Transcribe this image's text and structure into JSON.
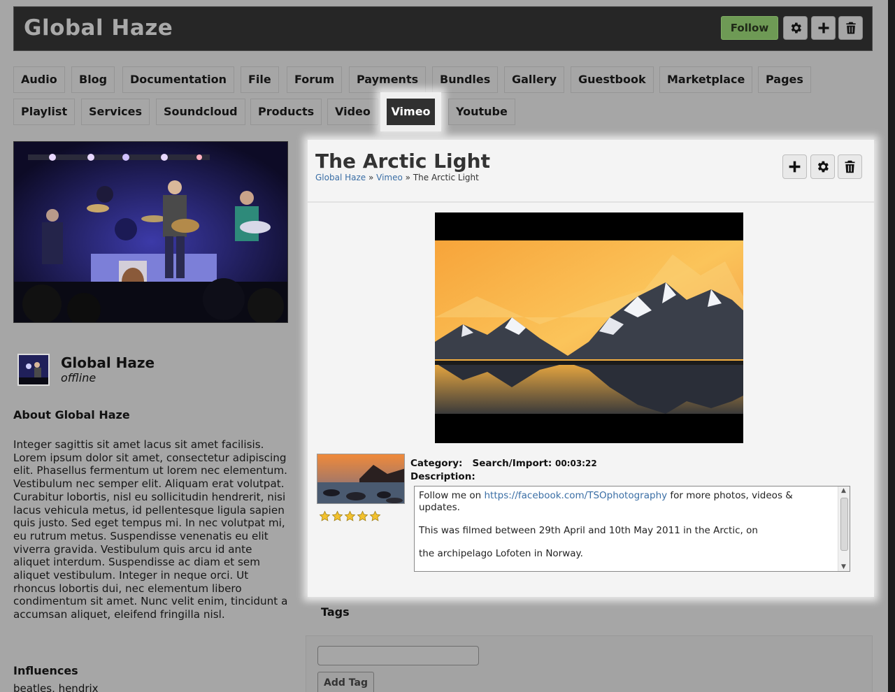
{
  "header": {
    "title": "Global Haze",
    "follow_label": "Follow"
  },
  "tabs": [
    "Audio",
    "Blog",
    "Documentation",
    "File",
    "Forum",
    "Payments",
    "Bundles",
    "Gallery",
    "Guestbook",
    "Marketplace",
    "Pages",
    "Playlist",
    "Services",
    "Soundcloud",
    "Products",
    "Video",
    "Vimeo",
    "Youtube"
  ],
  "active_tab": "Vimeo",
  "profile": {
    "name": "Global Haze",
    "status": "offline",
    "about_title": "About Global Haze",
    "about_text": "Integer sagittis sit amet lacus sit amet facilisis. Lorem ipsum dolor sit amet, consectetur adipiscing elit. Phasellus fermentum ut lorem nec elementum. Vestibulum nec semper elit. Aliquam erat volutpat. Curabitur lobortis, nisl eu sollicitudin hendrerit, nisi lacus vehicula metus, id pellentesque ligula sapien quis justo. Sed eget tempus mi. In nec volutpat mi, eu rutrum metus. Suspendisse venenatis eu elit viverra gravida. Vestibulum quis arcu id ante aliquet interdum. Suspendisse ac diam et sem aliquet vestibulum. Integer in neque orci. Ut rhoncus lobortis dui, nec elementum libero condimentum sit amet. Nunc velit enim, tincidunt a accumsan aliquet, eleifend fringilla nisl.",
    "influences_title": "Influences",
    "influences_text": "beatles, hendrix"
  },
  "item": {
    "title": "The Arctic Light",
    "breadcrumb": {
      "home": "Global Haze",
      "sep1": " » ",
      "section": "Vimeo",
      "sep2": " » ",
      "current": "The Arctic Light"
    },
    "category_label": "Category:",
    "search_label": "Search/Import:",
    "duration": "00:03:22",
    "description_label": "Description:",
    "description": {
      "line1_prefix": "Follow me on ",
      "line1_link": "https://facebook.com/TSOphotography",
      "line1_suffix": " for more photos, videos & updates.",
      "line2": "This was filmed between 29th April and 10th May 2011 in the Arctic, on",
      "line3": "the archipelago Lofoten in Norway."
    },
    "rating": 5
  },
  "tags": {
    "title": "Tags",
    "input_value": "",
    "add_label": "Add Tag"
  },
  "icons": {
    "settings": "gear-icon",
    "add": "plus-icon",
    "delete": "trash-icon",
    "star": "star-icon"
  },
  "colors": {
    "follow_button": "#6e9a55",
    "header_bg": "#262626",
    "active_tab_bg": "#303030",
    "link": "#3a6ea5",
    "star": "#f2c12e"
  }
}
